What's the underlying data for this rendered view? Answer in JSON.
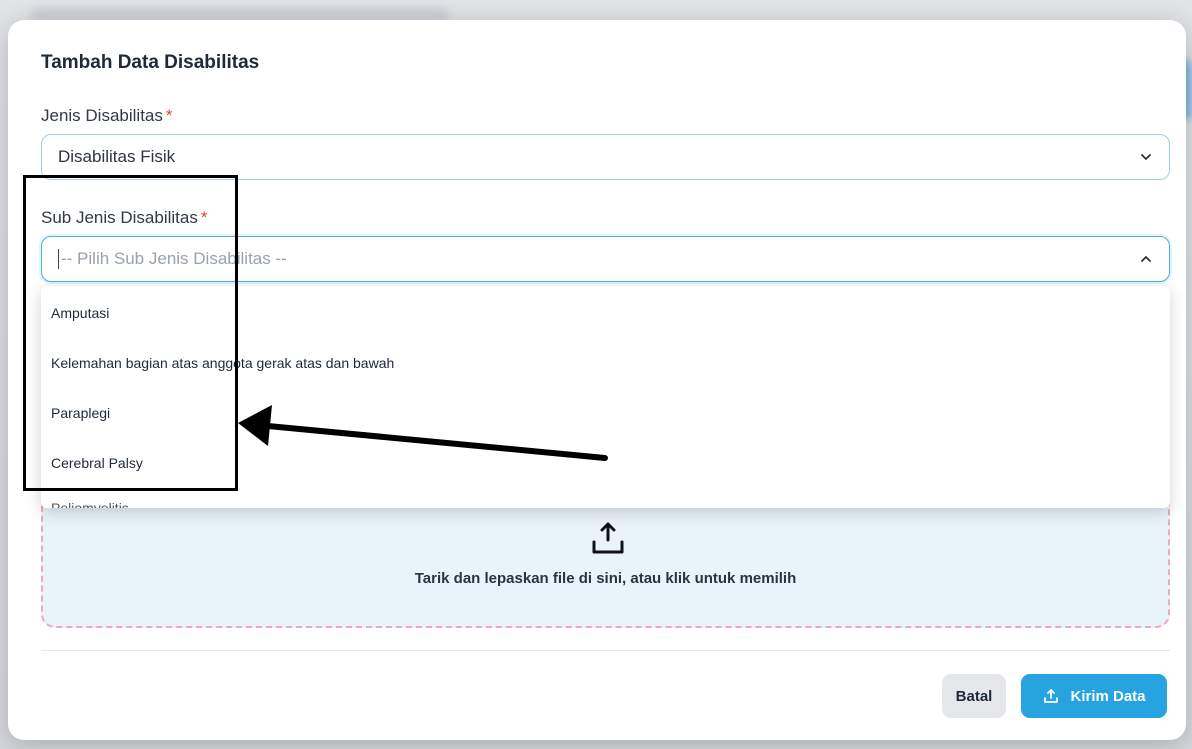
{
  "modal": {
    "title": "Tambah Data Disabilitas"
  },
  "jenis": {
    "label": "Jenis Disabilitas",
    "required_mark": "*",
    "value": "Disabilitas Fisik",
    "icon": "chevron-down-icon"
  },
  "sub_jenis": {
    "label": "Sub Jenis Disabilitas",
    "required_mark": "*",
    "placeholder": "-- Pilih Sub Jenis Disabilitas --",
    "icon": "chevron-up-icon",
    "options": [
      "Amputasi",
      "Kelemahan bagian atas anggota gerak atas dan bawah",
      "Paraplegi",
      "Cerebral Palsy",
      "Poliomyelitis"
    ]
  },
  "dropzone": {
    "icon": "upload-icon",
    "text": "Tarik dan lepaskan file di sini, atau klik untuk memilih"
  },
  "actions": {
    "cancel_label": "Batal",
    "submit_label": "Kirim Data",
    "submit_icon": "upload-icon"
  },
  "colors": {
    "accent": "#27a3e0",
    "required": "#e53e3e",
    "dropzone_border": "#f2a7c1",
    "dropzone_bg": "#e9f3fa"
  }
}
